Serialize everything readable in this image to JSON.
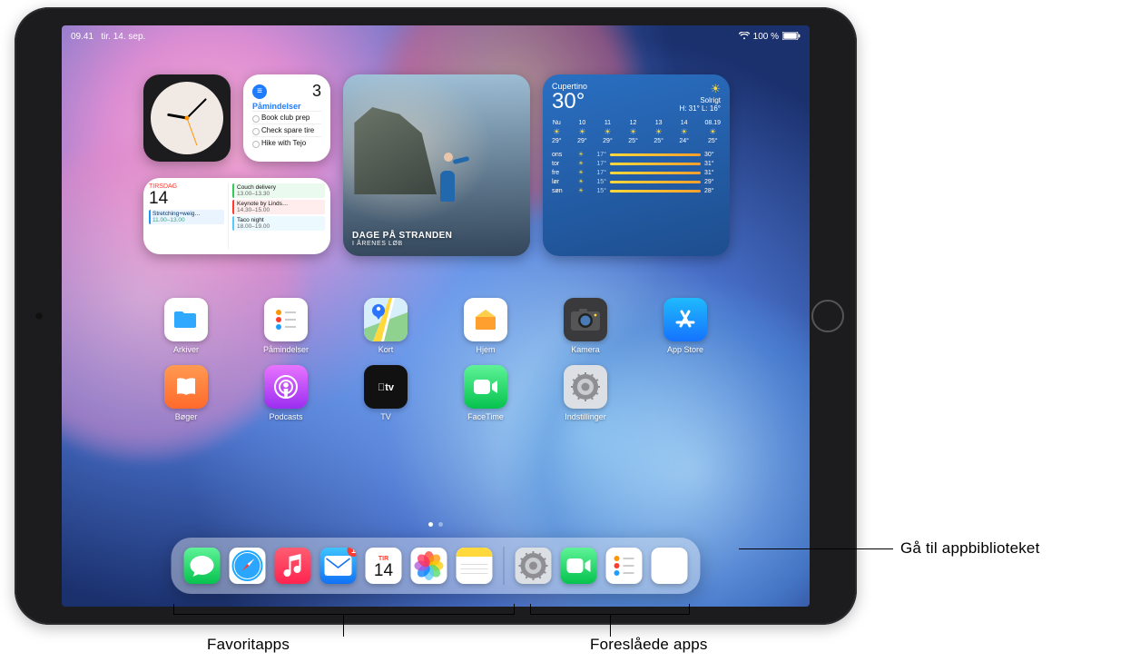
{
  "status_bar": {
    "time": "09.41",
    "date": "tir. 14. sep.",
    "battery": "100 %"
  },
  "widgets": {
    "reminders": {
      "title": "Påmindelser",
      "count": "3",
      "items": [
        "Book club prep",
        "Check spare tire",
        "Hike with Tejo"
      ]
    },
    "calendar": {
      "dow": "Tirsdag",
      "daynum": "14",
      "left_event": {
        "title": "Stretching+weig…",
        "time": "11.00–13.00"
      },
      "right_events": [
        {
          "title": "Couch delivery",
          "time": "13.00–13.30",
          "cls": "ce-g"
        },
        {
          "title": "Keynote by Linds…",
          "time": "14.30–15.00",
          "cls": "ce-r"
        },
        {
          "title": "Taco night",
          "time": "18.00–19.00",
          "cls": "ce-b"
        }
      ]
    },
    "photos": {
      "title": "DAGE PÅ STRANDEN",
      "subtitle": "I ÅRENES LØB"
    },
    "weather": {
      "location": "Cupertino",
      "temp": "30°",
      "condition": "Solrigt",
      "hilo": "H: 31° L: 16°",
      "hourly": [
        {
          "t": "Nu",
          "ic": "☀",
          "v": "29°"
        },
        {
          "t": "10",
          "ic": "☀",
          "v": "29°"
        },
        {
          "t": "11",
          "ic": "☀",
          "v": "29°"
        },
        {
          "t": "12",
          "ic": "☀",
          "v": "25°"
        },
        {
          "t": "13",
          "ic": "☀",
          "v": "25°"
        },
        {
          "t": "14",
          "ic": "☀",
          "v": "24°"
        },
        {
          "t": "08.19",
          "ic": "☀",
          "v": "25°"
        }
      ],
      "daily": [
        {
          "d": "ons",
          "ic": "☀",
          "lo": "17°",
          "hi": "30°"
        },
        {
          "d": "tor",
          "ic": "☀",
          "lo": "17°",
          "hi": "31°"
        },
        {
          "d": "fre",
          "ic": "☀",
          "lo": "17°",
          "hi": "31°"
        },
        {
          "d": "lør",
          "ic": "☀",
          "lo": "15°",
          "hi": "29°"
        },
        {
          "d": "søn",
          "ic": "☀",
          "lo": "15°",
          "hi": "28°"
        }
      ]
    }
  },
  "apps_row1": [
    {
      "name": "Arkiver",
      "bg": "#fff",
      "inner": "folder"
    },
    {
      "name": "Påmindelser",
      "bg": "#fff",
      "inner": "reminders-app"
    },
    {
      "name": "Kort",
      "bg": "#fff",
      "inner": "maps"
    },
    {
      "name": "Hjem",
      "bg": "#fff",
      "inner": "home"
    },
    {
      "name": "Kamera",
      "bg": "#3a3a3c",
      "inner": "camera"
    },
    {
      "name": "App Store",
      "bg": "linear-gradient(#1fbafc,#1573ff)",
      "inner": "appstore"
    }
  ],
  "apps_row2": [
    {
      "name": "Bøger",
      "bg": "linear-gradient(#ff9a52,#ff6a2b)",
      "inner": "books"
    },
    {
      "name": "Podcasts",
      "bg": "linear-gradient(#e874ff,#9b2ef0)",
      "inner": "podcasts"
    },
    {
      "name": "TV",
      "bg": "#111",
      "inner": "tv"
    },
    {
      "name": "FaceTime",
      "bg": "linear-gradient(#5ef397,#06c24e)",
      "inner": "facetime"
    },
    {
      "name": "Indstillinger",
      "bg": "#dcdfe3",
      "inner": "gear"
    },
    {
      "name": "",
      "bg": "",
      "inner": ""
    }
  ],
  "dock": {
    "favorites": [
      {
        "name": "Beskeder",
        "inner": "messages",
        "bg": "linear-gradient(#5ef397,#06c24e)"
      },
      {
        "name": "Safari",
        "inner": "safari",
        "bg": "#fff"
      },
      {
        "name": "Musik",
        "inner": "music",
        "bg": "linear-gradient(#ff5d71,#ff2450)"
      },
      {
        "name": "Mail",
        "inner": "mail",
        "bg": "linear-gradient(#3fc4ff,#1172f5)",
        "badge": "1"
      },
      {
        "name": "Kalender",
        "inner": "calendar",
        "bg": "#fff",
        "cal_dow": "TIR",
        "cal_day": "14"
      },
      {
        "name": "Fotos",
        "inner": "photos",
        "bg": "#fff"
      },
      {
        "name": "Noter",
        "inner": "notes",
        "bg": "#fff"
      }
    ],
    "suggested": [
      {
        "name": "Indstillinger",
        "inner": "gear",
        "bg": "#dcdfe3"
      },
      {
        "name": "FaceTime",
        "inner": "facetime",
        "bg": "linear-gradient(#5ef397,#06c24e)"
      },
      {
        "name": "Påmindelser",
        "inner": "reminders-app",
        "bg": "#fff"
      }
    ],
    "library": {
      "name": "Appbibliotek"
    }
  },
  "callouts": {
    "library": "Gå til appbiblioteket",
    "favorites": "Favoritapps",
    "suggested": "Foreslåede apps"
  }
}
